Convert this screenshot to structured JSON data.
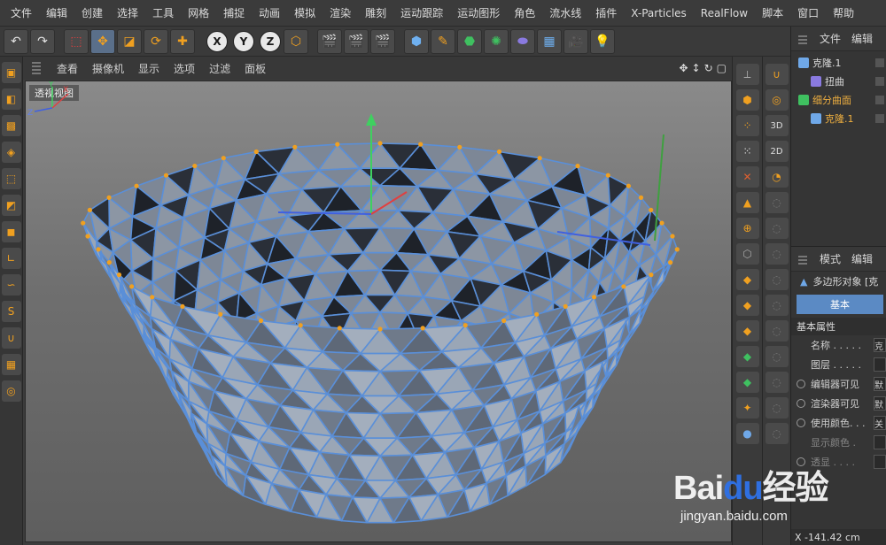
{
  "menu": [
    "文件",
    "编辑",
    "创建",
    "选择",
    "工具",
    "网格",
    "捕捉",
    "动画",
    "模拟",
    "渲染",
    "雕刻",
    "运动跟踪",
    "运动图形",
    "角色",
    "流水线",
    "插件",
    "X-Particles",
    "RealFlow",
    "脚本",
    "窗口",
    "帮助"
  ],
  "viewport_menu": [
    "查看",
    "摄像机",
    "显示",
    "选项",
    "过滤",
    "面板"
  ],
  "viewport_label": "透视视图",
  "object_manager": {
    "tabs": [
      "文件",
      "编辑"
    ],
    "items": [
      {
        "label": "克隆.1",
        "indent": 0,
        "color": "#6fa8e8",
        "selected": false
      },
      {
        "label": "扭曲",
        "indent": 1,
        "color": "#8a7ae0",
        "selected": false
      },
      {
        "label": "细分曲面",
        "indent": 0,
        "color": "#3fc060",
        "selected": true
      },
      {
        "label": "克隆.1",
        "indent": 1,
        "color": "#6fa8e8",
        "selected": true
      }
    ]
  },
  "attribute_manager": {
    "tabs": [
      "模式",
      "编辑"
    ],
    "object_title": "多边形对象 [克",
    "active_tab": "基本",
    "section": "基本属性",
    "rows": [
      {
        "label": "名称 . . . . .",
        "value": "克",
        "radio": false,
        "dim": false
      },
      {
        "label": "图层 . . . . .",
        "value": "",
        "radio": false,
        "dim": false
      },
      {
        "label": "编辑器可见",
        "value": "默",
        "radio": true,
        "dim": false
      },
      {
        "label": "渲染器可见",
        "value": "默",
        "radio": true,
        "dim": false
      },
      {
        "label": "使用颜色. . .",
        "value": "关",
        "radio": true,
        "dim": false
      },
      {
        "label": "显示颜色 .",
        "value": "",
        "radio": false,
        "dim": true
      },
      {
        "label": "透显 . . . .",
        "value": "",
        "radio": true,
        "dim": true
      }
    ],
    "coord": "X  -141.42 cm"
  },
  "watermark": {
    "logo_a": "Bai",
    "logo_b": "du",
    "logo_c": "经验",
    "url": "jingyan.baidu.com"
  },
  "colors": {
    "accent": "#5b8ac4",
    "mesh_fill": "#9aa6b6",
    "mesh_edge": "#5a8fd8",
    "point": "#f0a020"
  }
}
